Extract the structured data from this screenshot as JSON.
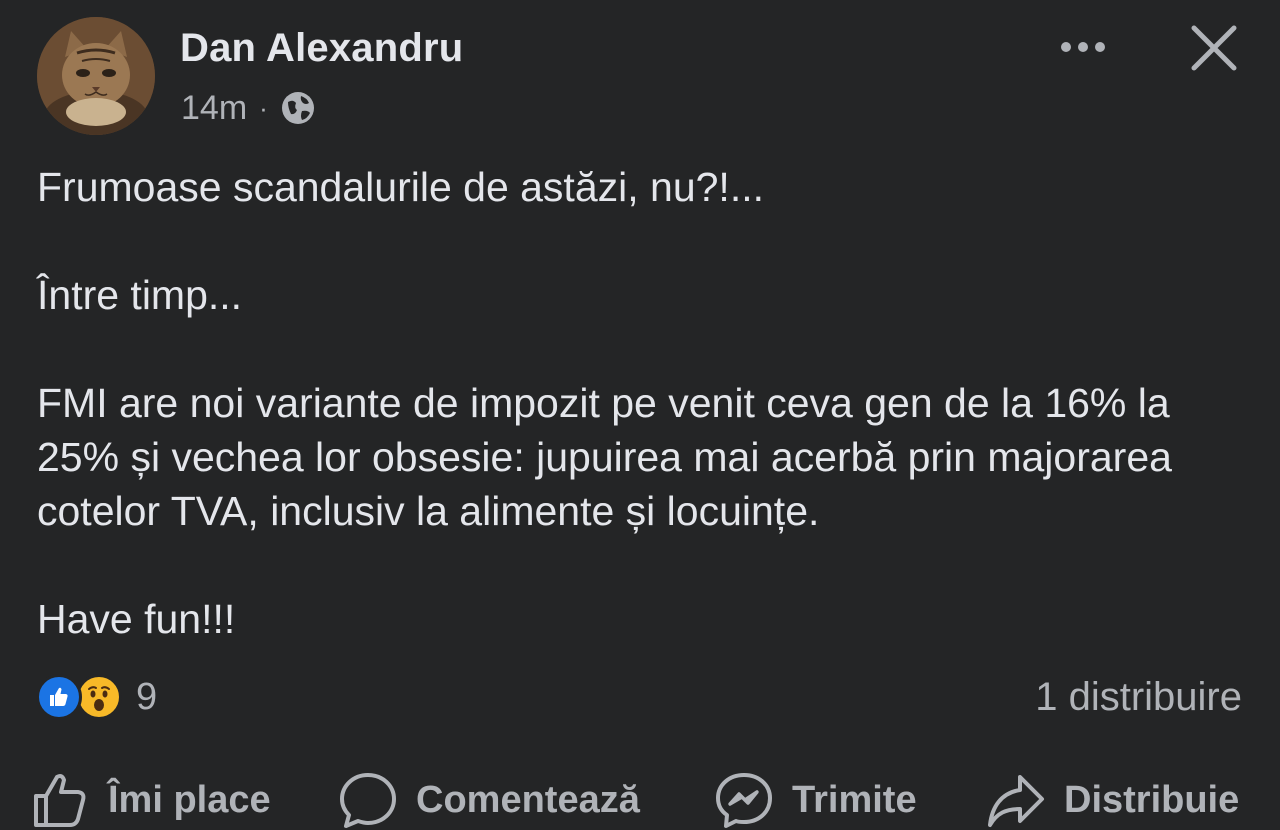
{
  "post": {
    "author": "Dan Alexandru",
    "time": "14m",
    "separator": "·",
    "privacy_icon": "globe-icon",
    "paragraphs": [
      "Frumoase scandalurile de astăzi, nu?!...",
      "Între timp...",
      "FMI are noi variante de impozit pe venit ceva gen de la 16% la 25% și vechea lor obsesie: jupuirea mai acerbă prin majorarea cotelor TVA, inclusiv la alimente și locuințe.",
      "Have fun!!!"
    ],
    "reactions": {
      "types": [
        "like",
        "wow"
      ],
      "count": "9"
    },
    "shares": "1 distribuire"
  },
  "header": {
    "more_icon": "more-dots-icon",
    "close_icon": "close-icon"
  },
  "actions": {
    "like": "Îmi place",
    "comment": "Comentează",
    "send": "Trimite",
    "share": "Distribuie"
  },
  "colors": {
    "background": "#242526",
    "text_primary": "#e4e6eb",
    "text_secondary": "#b0b3b8",
    "like_blue": "#1b74e4",
    "wow_yellow": "#f7b928"
  }
}
